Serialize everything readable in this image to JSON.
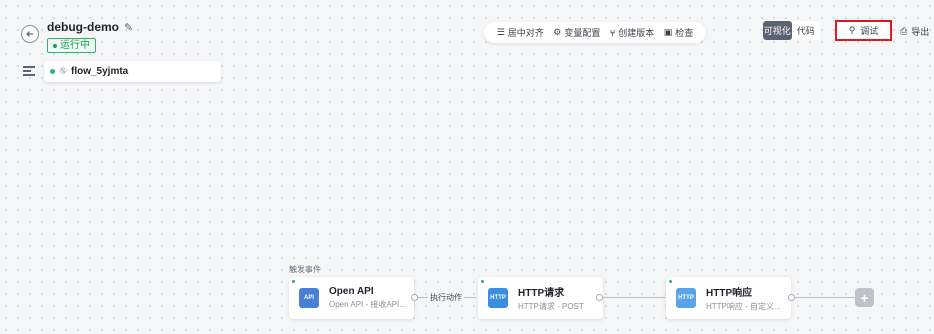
{
  "header": {
    "title": "debug-demo",
    "status": "运行中"
  },
  "flow": {
    "name": "flow_5yjmta"
  },
  "toolbar": {
    "center": "居中对齐",
    "variables": "变量配置",
    "version": "创建版本",
    "check": "检查"
  },
  "view": {
    "visual": "可视化",
    "code": "代码"
  },
  "actions": {
    "debug": "调试",
    "export": "导出"
  },
  "canvas": {
    "trigger_label": "触发事件",
    "edge_label": "执行动作",
    "nodes": [
      {
        "title": "Open API",
        "subtitle": "Open API - 接收API...",
        "icon": "API"
      },
      {
        "title": "HTTP请求",
        "subtitle": "HTTP请求 - POST",
        "icon": "HTTP"
      },
      {
        "title": "HTTP响应",
        "subtitle": "HTTP响应 - 自定义...",
        "icon": "HTTP"
      }
    ]
  },
  "colors": {
    "accent": "#2bb46b",
    "highlight": "#e0181f",
    "node_icon": "#4a7fd6"
  }
}
